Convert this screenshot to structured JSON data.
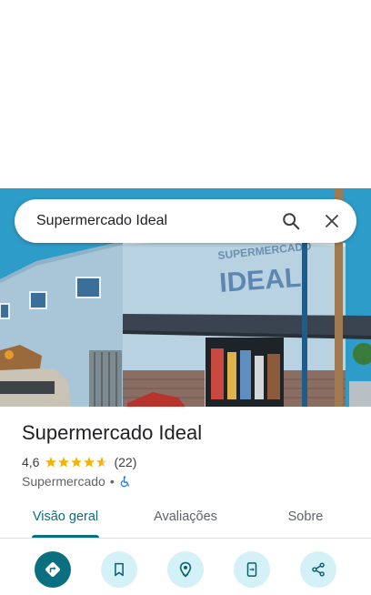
{
  "search": {
    "query": "Supermercado Ideal",
    "search_icon": "search-icon",
    "close_icon": "close-icon"
  },
  "hero": {
    "storefront_sign": "SUPERMERCADO IDEAL"
  },
  "place": {
    "name": "Supermercado Ideal",
    "rating": "4,6",
    "rating_stars": 4.6,
    "review_count": "(22)",
    "category": "Supermercado",
    "separator": "•",
    "accessibility_icon": "wheelchair-icon"
  },
  "tabs": [
    {
      "label": "Visão geral",
      "active": true
    },
    {
      "label": "Avaliações",
      "active": false
    },
    {
      "label": "Sobre",
      "active": false
    }
  ],
  "actions": [
    {
      "icon": "directions-icon",
      "primary": true
    },
    {
      "icon": "bookmark-icon",
      "primary": false
    },
    {
      "icon": "nearby-icon",
      "primary": false
    },
    {
      "icon": "send-to-phone-icon",
      "primary": false
    },
    {
      "icon": "share-icon",
      "primary": false
    }
  ],
  "colors": {
    "accent": "#0b6f80",
    "accent_light": "#d3f1f7",
    "star": "#f4b400",
    "text_primary": "#202124",
    "text_secondary": "#5f6368"
  }
}
